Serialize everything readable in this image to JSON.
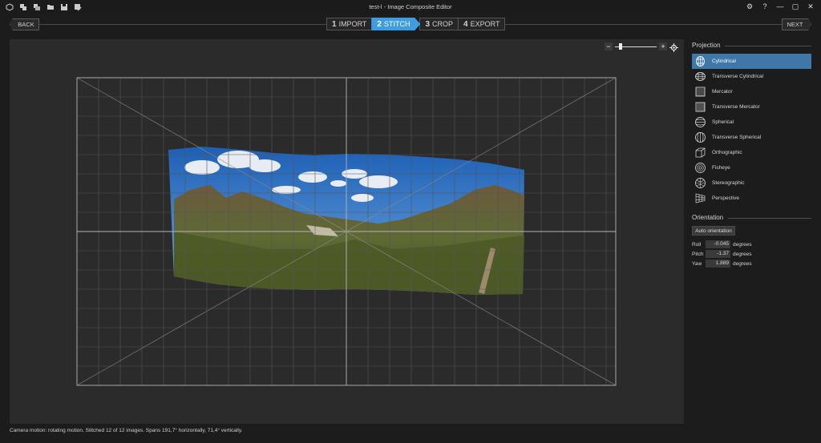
{
  "window": {
    "title": "test-l - Image Composite Editor",
    "controls": [
      "⚙",
      "?",
      "—",
      "▢",
      "✕"
    ]
  },
  "toolbar": {
    "icons": [
      "app-icon",
      "new-project-icon",
      "new-panorama-icon",
      "open-folder-icon",
      "save-icon",
      "save-as-icon"
    ]
  },
  "nav": {
    "back_label": "BACK",
    "next_label": "NEXT",
    "steps": [
      {
        "num": "1",
        "label": "IMPORT"
      },
      {
        "num": "2",
        "label": "STITCH"
      },
      {
        "num": "3",
        "label": "CROP"
      },
      {
        "num": "4",
        "label": "EXPORT"
      }
    ],
    "active_step": "STITCH"
  },
  "zoom": {
    "minus": "−",
    "plus": "+",
    "level_fraction": 0.1
  },
  "status": {
    "text": "Camera motion: rotating motion. Stitched 12 of 12 images. Spans 191,7° horizontally, 71,4° vertically."
  },
  "projection": {
    "title": "Projection",
    "selected": "Cylindrical",
    "items": [
      {
        "label": "Cylindrical",
        "icon": "cylindrical-icon"
      },
      {
        "label": "Transverse Cylindrical",
        "icon": "transverse-cylindrical-icon"
      },
      {
        "label": "Mercator",
        "icon": "mercator-icon"
      },
      {
        "label": "Transverse Mercator",
        "icon": "transverse-mercator-icon"
      },
      {
        "label": "Spherical",
        "icon": "spherical-icon"
      },
      {
        "label": "Transverse Spherical",
        "icon": "transverse-spherical-icon"
      },
      {
        "label": "Orthographic",
        "icon": "orthographic-icon"
      },
      {
        "label": "Fisheye",
        "icon": "fisheye-icon"
      },
      {
        "label": "Stereographic",
        "icon": "stereographic-icon"
      },
      {
        "label": "Perspective",
        "icon": "perspective-icon"
      }
    ]
  },
  "orientation": {
    "title": "Orientation",
    "auto_label": "Auto orientation",
    "unit": "degrees",
    "roll": {
      "label": "Roll",
      "value": "-0.045"
    },
    "pitch": {
      "label": "Pitch",
      "value": "-1.37"
    },
    "yaw": {
      "label": "Yaw",
      "value": "1.889"
    }
  },
  "colors": {
    "accent": "#3d9de0",
    "selected_item": "#3f77a8",
    "canvas_bg": "#2b2b2b"
  }
}
